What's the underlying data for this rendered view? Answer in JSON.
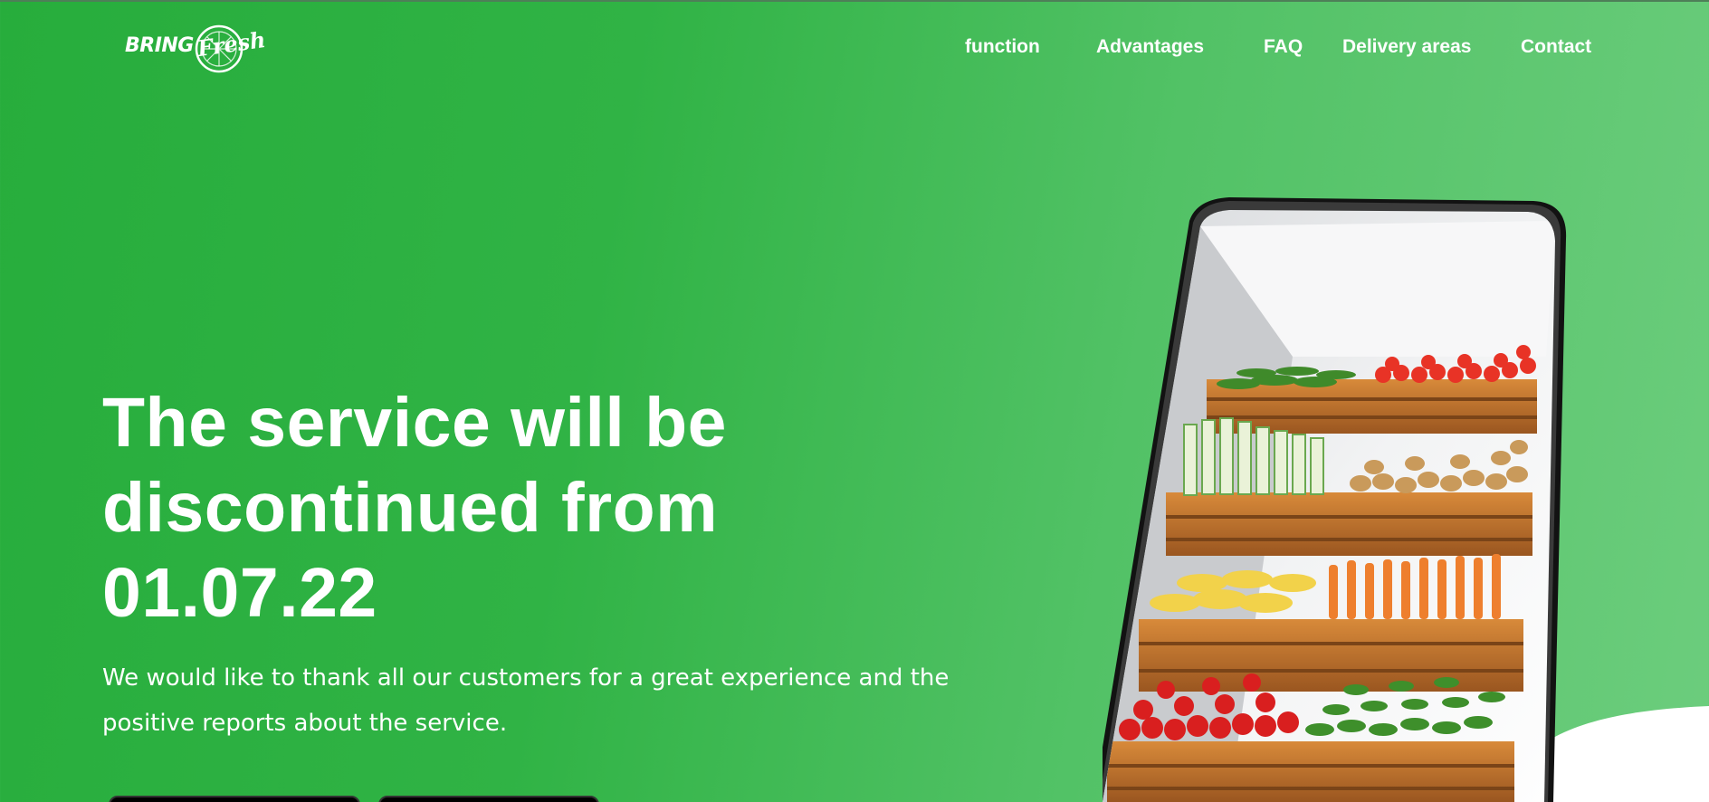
{
  "brand": {
    "part1": "Bring",
    "part2": "Fresh",
    "logo_icon": "lime-slice-icon"
  },
  "nav": {
    "items": [
      {
        "label": "function"
      },
      {
        "label": "Advantages"
      },
      {
        "label": "FAQ"
      },
      {
        "label": "Delivery areas"
      },
      {
        "label": "Contact"
      }
    ]
  },
  "hero": {
    "title_line1": "The service will be",
    "title_line2": "discontinued from",
    "title_line3": "01.07.22",
    "text": "We would like to thank all our customers for a great experience and the positive reports about the service."
  },
  "colors": {
    "primary_green": "#2fb244",
    "light_green": "#6ccd7d",
    "text": "#ffffff"
  },
  "illustration": {
    "name": "phone-with-vegetable-crates"
  }
}
